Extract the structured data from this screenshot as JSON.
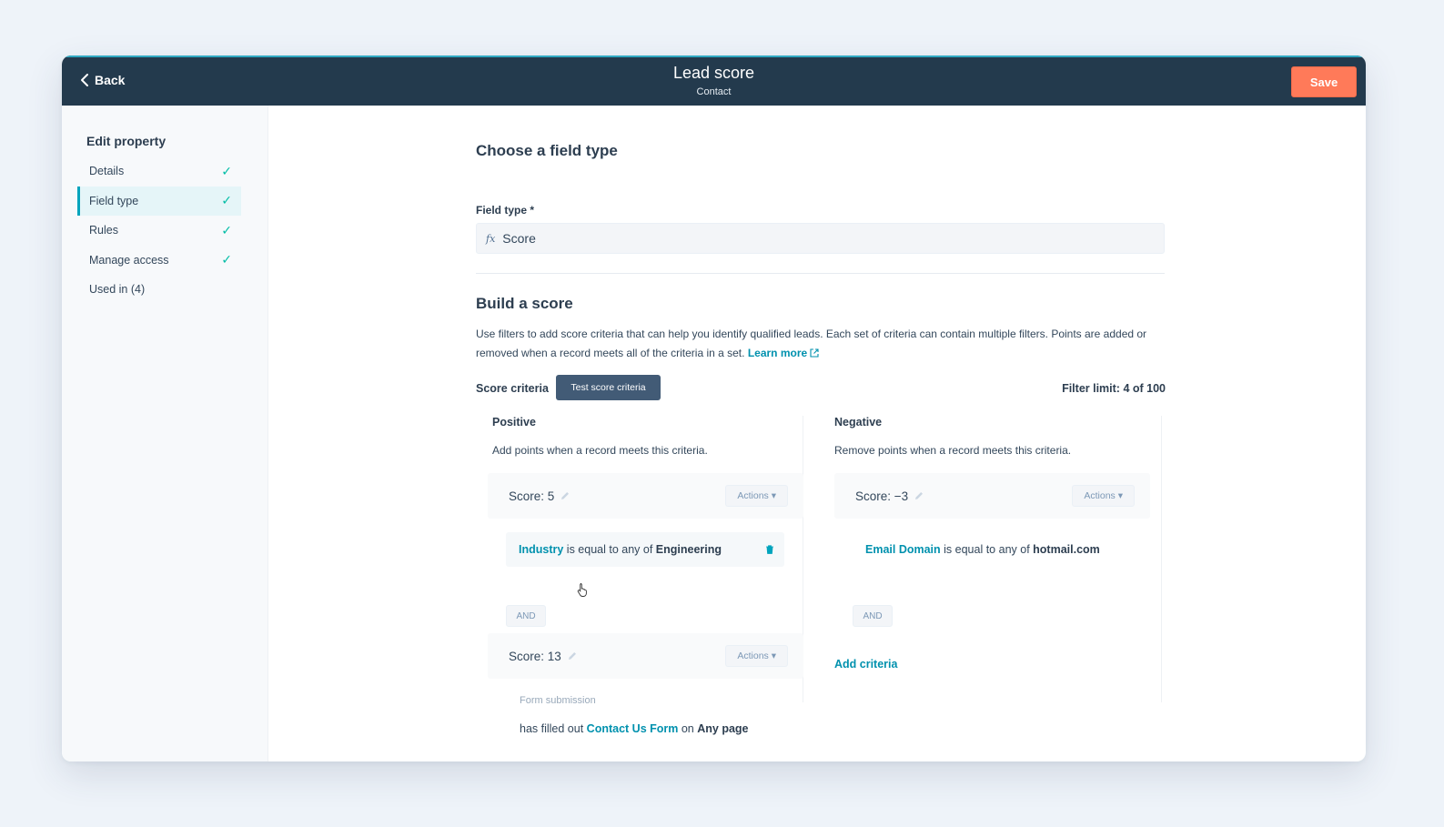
{
  "header": {
    "back_label": "Back",
    "title": "Lead score",
    "subtitle": "Contact",
    "save_label": "Save"
  },
  "sidebar": {
    "title": "Edit property",
    "items": [
      {
        "label": "Details",
        "checked": true,
        "active": false
      },
      {
        "label": "Field type",
        "checked": true,
        "active": true
      },
      {
        "label": "Rules",
        "checked": true,
        "active": false
      },
      {
        "label": "Manage access",
        "checked": true,
        "active": false
      },
      {
        "label": "Used in (4)",
        "checked": false,
        "active": false
      }
    ]
  },
  "main": {
    "field_type_heading": "Choose a field type",
    "field_type_label": "Field type *",
    "field_type_icon": "fx",
    "field_type_value": "Score",
    "build_heading": "Build a score",
    "description": "Use filters to add score criteria that can help you identify qualified leads. Each set of criteria can contain multiple filters. Points are added or removed when a record meets all of the criteria in a set.",
    "learn_more": "Learn more",
    "score_criteria_label": "Score criteria",
    "test_button": "Test score criteria",
    "filter_limit": "Filter limit: 4 of 100",
    "positive": {
      "title": "Positive",
      "subtitle": "Add points when a record meets this criteria.",
      "cards": [
        {
          "score": "Score: 5",
          "actions": "Actions",
          "filter": {
            "property": "Industry",
            "operator": "is equal to any of",
            "value": "Engineering"
          },
          "and_label": "AND"
        },
        {
          "score": "Score: 13",
          "actions": "Actions",
          "group_label": "Form submission",
          "filter": {
            "prefix": "has filled out",
            "form": "Contact Us Form",
            "mid": "on",
            "page": "Any page"
          }
        }
      ]
    },
    "negative": {
      "title": "Negative",
      "subtitle": "Remove points when a record meets this criteria.",
      "cards": [
        {
          "score": "Score: −3",
          "actions": "Actions",
          "filter": {
            "property": "Email Domain",
            "operator": "is equal to any of",
            "value": "hotmail.com"
          },
          "and_label": "AND"
        }
      ],
      "add_criteria": "Add criteria"
    }
  },
  "colors": {
    "header_bg": "#233a4d",
    "accent_teal": "#00a4bd",
    "save_orange": "#ff7a59",
    "link": "#0091ae",
    "check": "#00bda5"
  }
}
